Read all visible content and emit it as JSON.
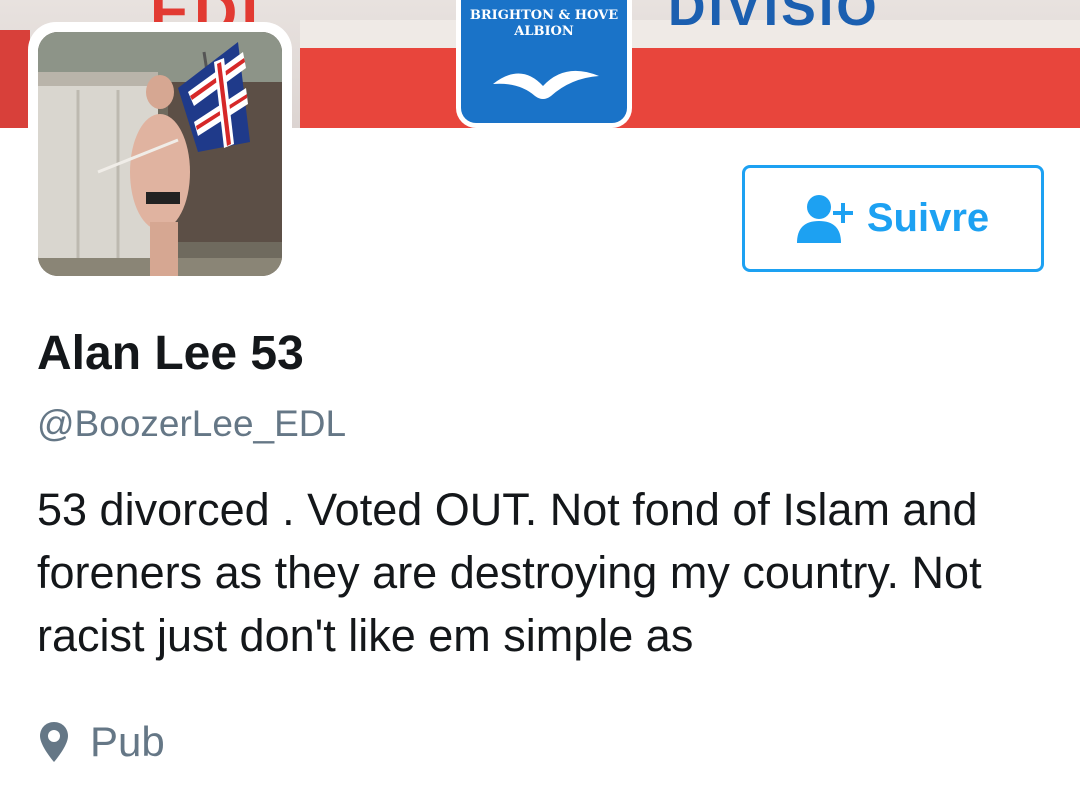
{
  "banner": {
    "text_left": "EDL",
    "badge_text": "BRIGHTON & HOVE ALBION",
    "text_right": "DIVISIO"
  },
  "profile": {
    "name": "Alan Lee 53",
    "handle": "@BoozerLee_EDL",
    "bio": "53 divorced . Voted OUT. Not fond of Islam and foreners as they are destroying my country. Not racist just don't like em simple as",
    "location": "Pub"
  },
  "follow_button": {
    "label": "Suivre",
    "icon": "user-plus-icon"
  },
  "colors": {
    "accent": "#1da1f2",
    "secondary_text": "#657786",
    "primary_text": "#14171a"
  }
}
